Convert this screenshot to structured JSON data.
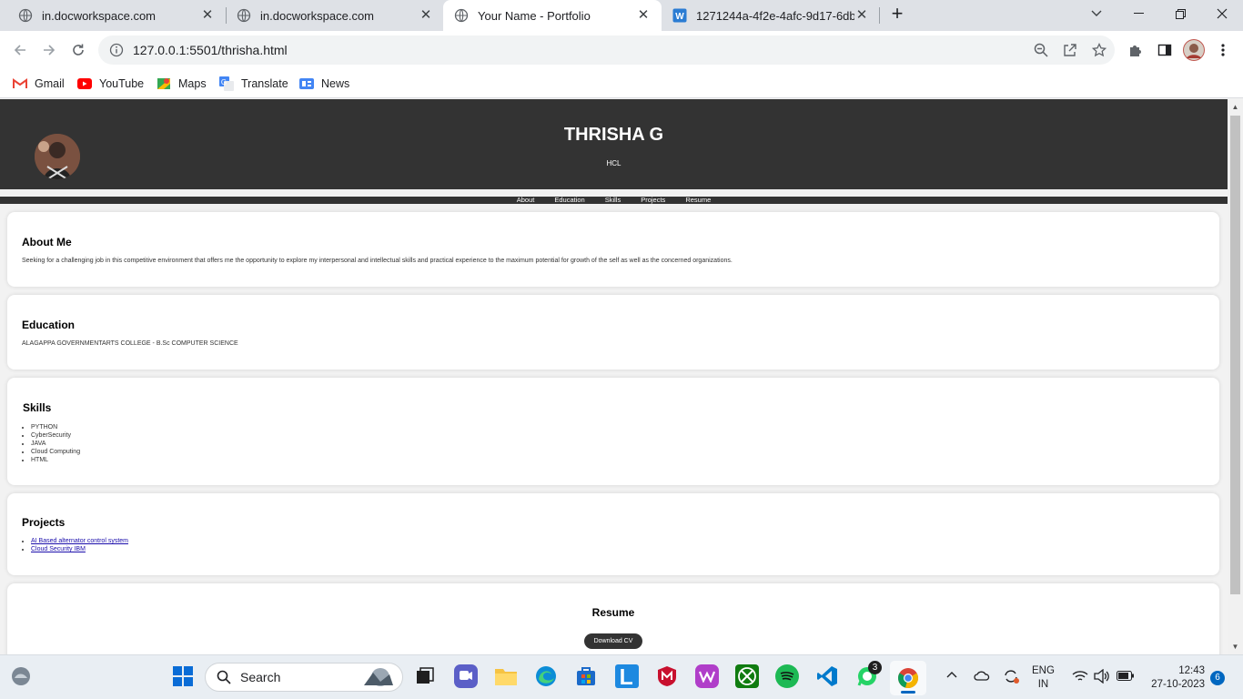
{
  "browser": {
    "tabs": [
      {
        "title": "in.docworkspace.com",
        "active": false
      },
      {
        "title": "in.docworkspace.com",
        "active": false
      },
      {
        "title": "Your Name - Portfolio",
        "active": true
      },
      {
        "title": "1271244a-4f2e-4afc-9d17-6db1",
        "active": false
      }
    ],
    "url": "127.0.0.1:5501/thrisha.html",
    "bookmarks": [
      "Gmail",
      "YouTube",
      "Maps",
      "Translate",
      "News"
    ]
  },
  "page": {
    "header": {
      "name": "THRISHA G",
      "subtitle": "HCL"
    },
    "nav": [
      "About",
      "Education",
      "Skills",
      "Projects",
      "Resume"
    ],
    "about": {
      "title": "About Me",
      "text": "Seeking for a challenging job in this competitive environment that offers me the opportunity to explore my interpersonal and intellectual skills and practical experience to the maximum potential for growth of the self as well as the concerned organizations."
    },
    "education": {
      "title": "Education",
      "text": "ALAGAPPA GOVERNMENTARTS COLLEGE - B.Sc COMPUTER SCIENCE"
    },
    "skills": {
      "title": "Skills",
      "items": [
        "PYTHON",
        "CyberSecurity",
        "JAVA",
        "Cloud Computing",
        "HTML"
      ]
    },
    "projects": {
      "title": "Projects",
      "items": [
        "AI Based alternator control system",
        "Cloud Security IBM"
      ]
    },
    "resume": {
      "title": "Resume",
      "button": "Download CV"
    }
  },
  "taskbar": {
    "search_placeholder": "Search",
    "whatsapp_badge": "3",
    "lang_line1": "ENG",
    "lang_line2": "IN",
    "time": "12:43",
    "date": "27-10-2023",
    "notification_count": "6"
  },
  "colors": {
    "header_bg": "#333333",
    "page_bg": "#f2f2f2",
    "link": "#1a0dab"
  }
}
